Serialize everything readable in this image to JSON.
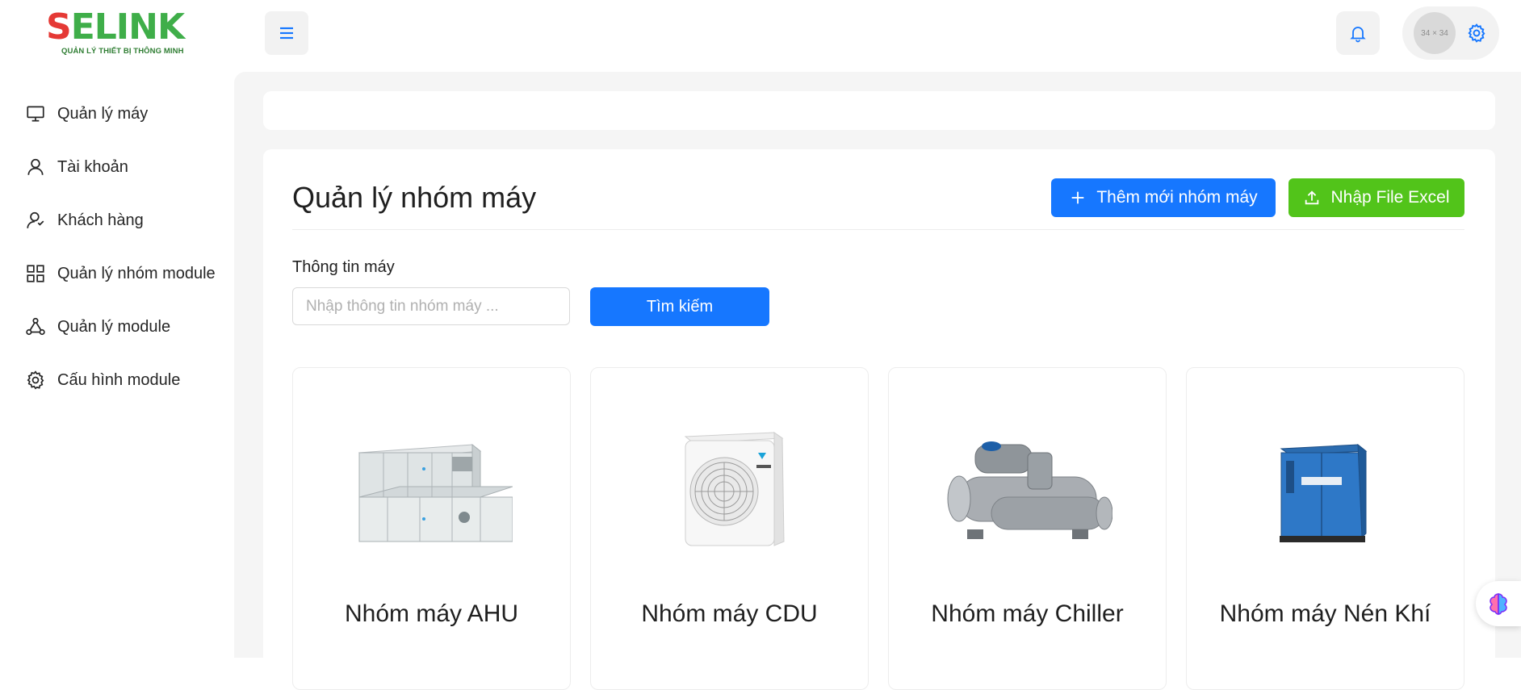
{
  "brand": {
    "logo_letter": "S",
    "logo_rest": "ELINK",
    "tagline": "QUẢN LÝ THIẾT BỊ THÔNG MINH",
    "colors": {
      "primary": "#1677ff",
      "success": "#52c41a",
      "logo_green": "#3fae49",
      "logo_red": "#e53935"
    }
  },
  "sidebar": {
    "items": [
      {
        "label": "Quản lý máy",
        "icon": "monitor-icon"
      },
      {
        "label": "Tài khoản",
        "icon": "user-icon"
      },
      {
        "label": "Khách hàng",
        "icon": "customers-icon"
      },
      {
        "label": "Quản lý nhóm module",
        "icon": "grid-icon"
      },
      {
        "label": "Quản lý module",
        "icon": "nodes-icon"
      },
      {
        "label": "Cấu hình module",
        "icon": "gear-icon"
      }
    ]
  },
  "header": {
    "avatar_placeholder": "34 × 34"
  },
  "page": {
    "title": "Quản lý nhóm máy",
    "add_button": "Thêm mới nhóm máy",
    "import_button": "Nhập File Excel",
    "search_label": "Thông tin máy",
    "search_placeholder": "Nhập thông tin nhóm máy ...",
    "search_button": "Tìm kiếm"
  },
  "groups": [
    {
      "name": "Nhóm máy AHU"
    },
    {
      "name": "Nhóm máy CDU"
    },
    {
      "name": "Nhóm máy Chiller"
    },
    {
      "name": "Nhóm máy Nén Khí"
    }
  ]
}
